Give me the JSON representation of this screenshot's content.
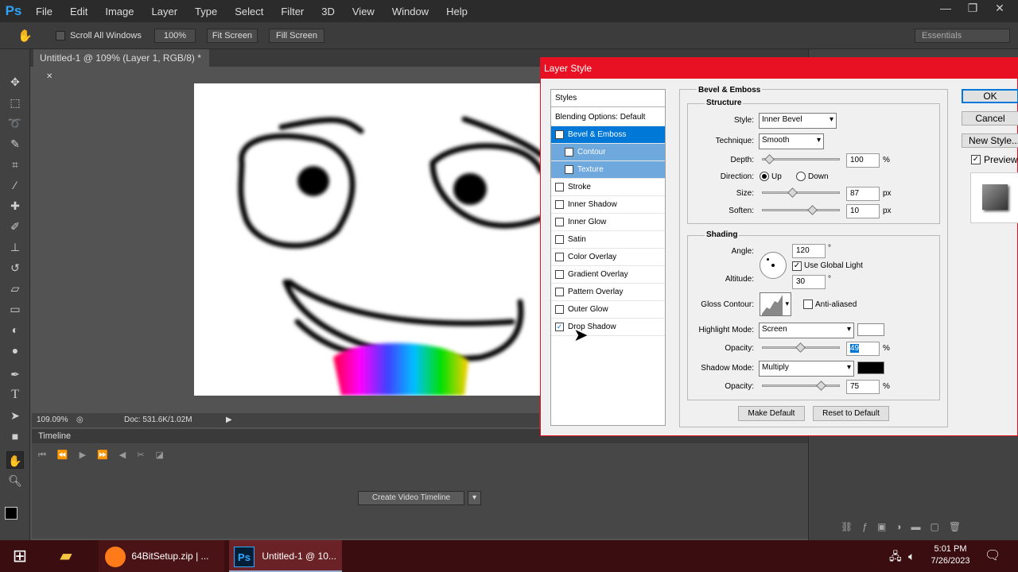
{
  "menubar": {
    "logo": "Ps",
    "items": [
      "File",
      "Edit",
      "Image",
      "Layer",
      "Type",
      "Select",
      "Filter",
      "3D",
      "View",
      "Window",
      "Help"
    ]
  },
  "options": {
    "scroll_all": "Scroll All Windows",
    "zoom_100": "100%",
    "fit_screen": "Fit Screen",
    "fill_screen": "Fill Screen",
    "workspace": "Essentials"
  },
  "document": {
    "tab_title": "Untitled-1 @ 109% (Layer 1, RGB/8) *",
    "zoom": "109.09%",
    "doc_size": "Doc: 531.6K/1.02M"
  },
  "timeline": {
    "title": "Timeline",
    "create_btn": "Create Video Timeline"
  },
  "dialog": {
    "title": "Layer Style",
    "styles_header": "Styles",
    "blending": "Blending Options: Default",
    "styles": [
      {
        "label": "Bevel & Emboss",
        "checked": true
      },
      {
        "label": "Contour",
        "checked": false
      },
      {
        "label": "Texture",
        "checked": false
      },
      {
        "label": "Stroke",
        "checked": false
      },
      {
        "label": "Inner Shadow",
        "checked": false
      },
      {
        "label": "Inner Glow",
        "checked": false
      },
      {
        "label": "Satin",
        "checked": false
      },
      {
        "label": "Color Overlay",
        "checked": false
      },
      {
        "label": "Gradient Overlay",
        "checked": false
      },
      {
        "label": "Pattern Overlay",
        "checked": false
      },
      {
        "label": "Outer Glow",
        "checked": false
      },
      {
        "label": "Drop Shadow",
        "checked": true
      }
    ],
    "section_title": "Bevel & Emboss",
    "structure": {
      "title": "Structure",
      "style_label": "Style:",
      "style_value": "Inner Bevel",
      "technique_label": "Technique:",
      "technique_value": "Smooth",
      "depth_label": "Depth:",
      "depth_value": "100",
      "depth_unit": "%",
      "direction_label": "Direction:",
      "up": "Up",
      "down": "Down",
      "size_label": "Size:",
      "size_value": "87",
      "size_unit": "px",
      "soften_label": "Soften:",
      "soften_value": "10",
      "soften_unit": "px"
    },
    "shading": {
      "title": "Shading",
      "angle_label": "Angle:",
      "angle_value": "120",
      "deg": "°",
      "use_global": "Use Global Light",
      "altitude_label": "Altitude:",
      "altitude_value": "30",
      "gloss_label": "Gloss Contour:",
      "anti_aliased": "Anti-aliased",
      "highlight_label": "Highlight Mode:",
      "highlight_value": "Screen",
      "hl_opacity_label": "Opacity:",
      "hl_opacity_value": "49",
      "pct": "%",
      "shadow_label": "Shadow Mode:",
      "shadow_value": "Multiply",
      "sh_opacity_label": "Opacity:",
      "sh_opacity_value": "75"
    },
    "make_default": "Make Default",
    "reset_default": "Reset to Default",
    "ok": "OK",
    "cancel": "Cancel",
    "new_style": "New Style...",
    "preview": "Preview"
  },
  "taskbar": {
    "firefox_task": "64BitSetup.zip | ...",
    "ps_task": "Untitled-1 @ 10...",
    "time": "5:01 PM",
    "date": "7/26/2023"
  },
  "colors": {
    "accent": "#e81123",
    "selected": "#0078d7",
    "subsel": "#6fa8dc"
  }
}
